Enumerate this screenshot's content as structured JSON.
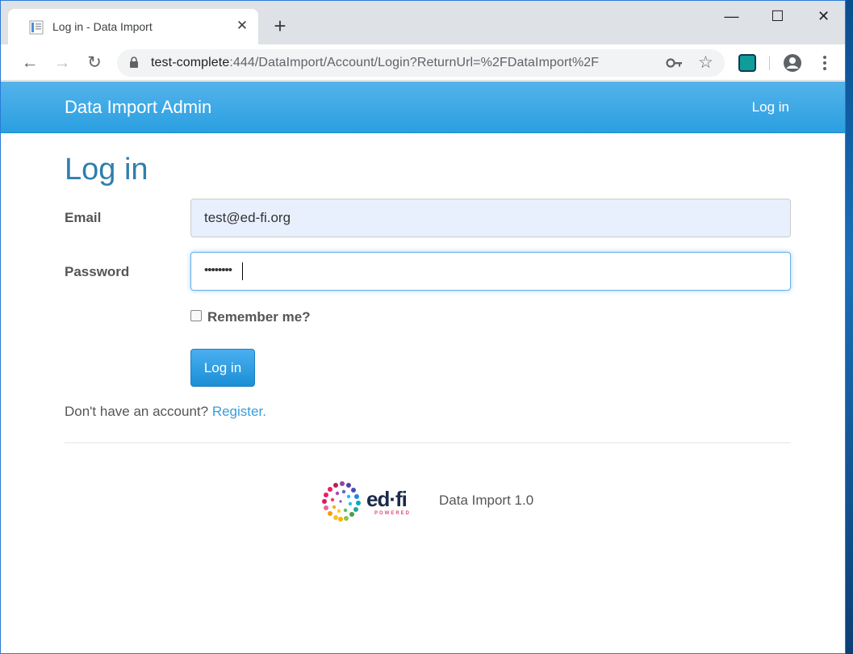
{
  "browser": {
    "tab": {
      "title": "Log in - Data Import",
      "close_glyph": "✕"
    },
    "new_tab_glyph": "+",
    "window_controls": {
      "minimize": "—",
      "maximize": "☐",
      "close": "✕"
    },
    "nav": {
      "back": "←",
      "forward": "→",
      "reload": "↻"
    },
    "url": {
      "host": "test-complete",
      "rest": ":444/DataImport/Account/Login?ReturnUrl=%2FDataImport%2F"
    },
    "star_glyph": "☆"
  },
  "navbar": {
    "brand": "Data Import Admin",
    "login_link": "Log in"
  },
  "main": {
    "title": "Log in",
    "email": {
      "label": "Email",
      "value": "test@ed-fi.org"
    },
    "password": {
      "label": "Password",
      "masked_value": "••••••••"
    },
    "remember_label": "Remember me?",
    "submit_label": "Log in",
    "register_prompt": "Don't have an account?",
    "register_link": "Register."
  },
  "footer": {
    "logo_word": "ed·fi",
    "logo_tagline": "POWERED",
    "version": "Data Import 1.0"
  },
  "colors": {
    "accent": "#2a9fe0",
    "title": "#317eac",
    "link": "#3a9dd9"
  }
}
